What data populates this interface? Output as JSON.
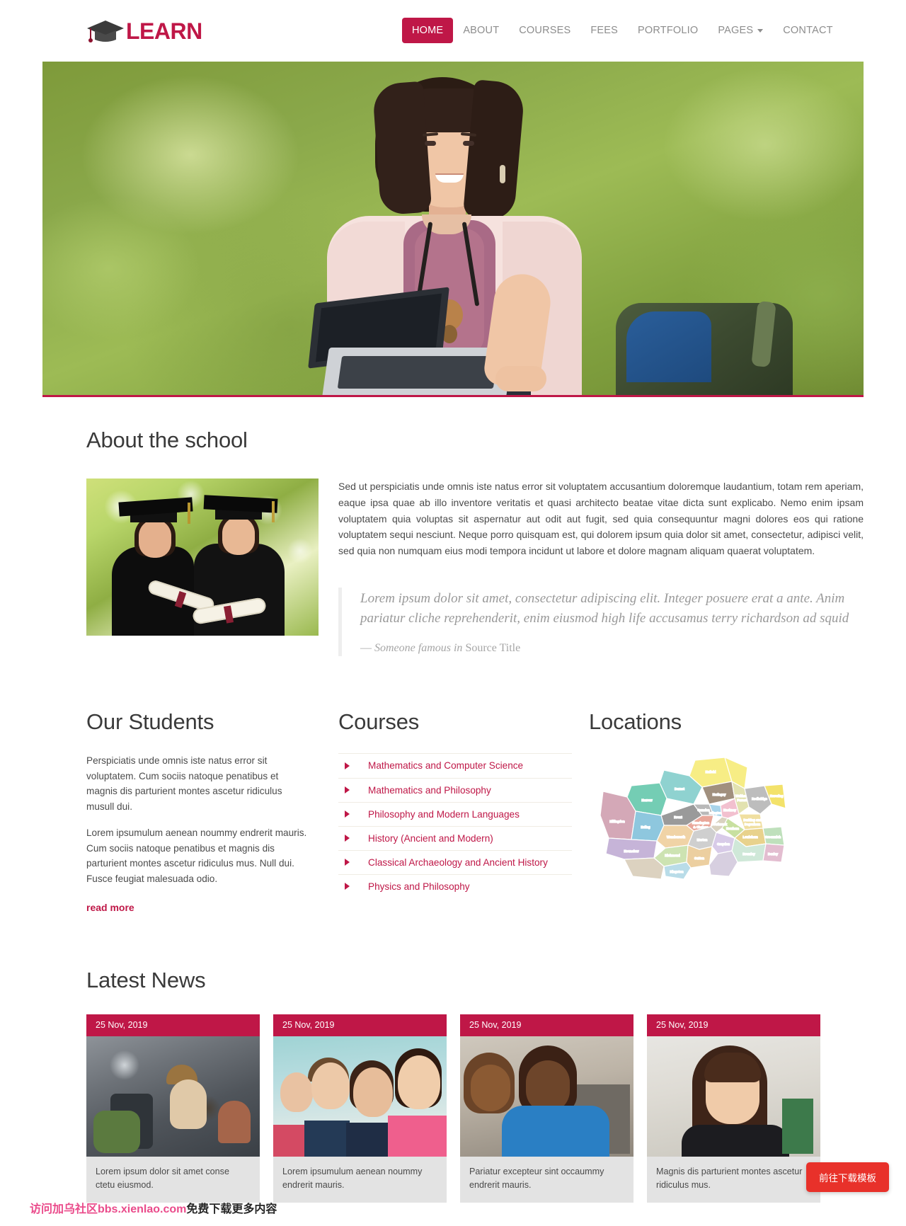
{
  "header": {
    "brand": {
      "text": "LEARN",
      "icon": "graduation-cap-icon",
      "color": "#bf1747"
    },
    "nav": [
      {
        "label": "HOME",
        "active": true
      },
      {
        "label": "ABOUT",
        "active": false
      },
      {
        "label": "COURSES",
        "active": false
      },
      {
        "label": "FEES",
        "active": false
      },
      {
        "label": "PORTFOLIO",
        "active": false
      },
      {
        "label": "PAGES",
        "active": false,
        "has_caret": true
      },
      {
        "label": "CONTACT",
        "active": false
      }
    ]
  },
  "hero": {
    "alt": "Student sitting outdoors with a laptop and backpack on a green bokeh background"
  },
  "about": {
    "title": "About the school",
    "image_alt": "Two graduates in caps and gowns holding diplomas",
    "paragraph": "Sed ut perspiciatis unde omnis iste natus error sit voluptatem accusantium doloremque laudantium, totam rem aperiam, eaque ipsa quae ab illo inventore veritatis et quasi architecto beatae vitae dicta sunt explicabo. Nemo enim ipsam voluptatem quia voluptas sit aspernatur aut odit aut fugit, sed quia consequuntur magni dolores eos qui ratione voluptatem sequi nesciunt. Neque porro quisquam est, qui dolorem ipsum quia dolor sit amet, consectetur, adipisci velit, sed quia non numquam eius modi tempora incidunt ut labore et dolore magnam aliquam quaerat voluptatem.",
    "quote": "Lorem ipsum dolor sit amet, consectetur adipiscing elit. Integer posuere erat a ante. Anim pariatur cliche reprehenderit, enim eiusmod high life accusamus terry richardson ad squid",
    "quote_dash": "—",
    "quote_author": "Someone famous",
    "quote_joiner": "in",
    "quote_source": "Source Title"
  },
  "students": {
    "title": "Our Students",
    "paragraphs": [
      "Perspiciatis unde omnis iste natus error sit voluptatem. Cum sociis natoque penatibus et magnis dis parturient montes ascetur ridiculus musull dui.",
      "Lorem ipsumulum aenean noummy endrerit mauris. Cum sociis natoque penatibus et magnis dis parturient montes ascetur ridiculus mus. Null dui. Fusce feugiat malesuada odio."
    ],
    "read_more": "read more"
  },
  "courses": {
    "title": "Courses",
    "items": [
      "Mathematics and Computer Science",
      "Mathematics and Philosophy",
      "Philosophy and Modern Languages",
      "History (Ancient and Modern)",
      "Classical Archaeology and Ancient History",
      "Physics and Philosophy"
    ]
  },
  "locations": {
    "title": "Locations",
    "map_alt": "Colour-coded map of the London boroughs",
    "boroughs": [
      {
        "name": "Enfield",
        "color": "#f7ed85"
      },
      {
        "name": "Barnet",
        "color": "#8fd2d0"
      },
      {
        "name": "Harrow",
        "color": "#74cdb4"
      },
      {
        "name": "Hillingdon",
        "color": "#d4a8b7"
      },
      {
        "name": "Brent",
        "color": "#9a9a9a"
      },
      {
        "name": "Haringey",
        "color": "#a1907e"
      },
      {
        "name": "Waltham Forest",
        "color": "#e2e2b0"
      },
      {
        "name": "Redbridge",
        "color": "#bdbdbd"
      },
      {
        "name": "Havering",
        "color": "#f3e26a"
      },
      {
        "name": "Camden",
        "color": "#b9b9b9"
      },
      {
        "name": "Islington",
        "color": "#a8d4ea"
      },
      {
        "name": "Hackney",
        "color": "#f2c0cf"
      },
      {
        "name": "Barking and Dagenham",
        "color": "#f0dfa0"
      },
      {
        "name": "Ealing",
        "color": "#8ec7de"
      },
      {
        "name": "Kensington & Chelsea",
        "color": "#e9a79a"
      },
      {
        "name": "Newham",
        "color": "#c8e0a0"
      },
      {
        "name": "Hounslow",
        "color": "#c6b4d8"
      },
      {
        "name": "Wandsworth",
        "color": "#f0d3a6"
      },
      {
        "name": "Southwark",
        "color": "#a7c7e0"
      },
      {
        "name": "Lewisham",
        "color": "#e8d28c"
      },
      {
        "name": "Greenwich",
        "color": "#bfe0bc"
      },
      {
        "name": "Bexley",
        "color": "#e3bdd0"
      },
      {
        "name": "Richmond",
        "color": "#cde3b2"
      },
      {
        "name": "Merton",
        "color": "#cfcfcf"
      },
      {
        "name": "Croydon",
        "color": "#d8cbe8"
      },
      {
        "name": "Bromley",
        "color": "#cfe8d8"
      },
      {
        "name": "Sutton",
        "color": "#eccfa0"
      },
      {
        "name": "Kingston",
        "color": "#b9dce8"
      }
    ]
  },
  "news": {
    "title": "Latest News",
    "cards": [
      {
        "date": "25 Nov, 2019",
        "caption": "Lorem ipsum dolor sit amet conse ctetu eiusmod.",
        "image_alt": "Students working at computers in a classroom"
      },
      {
        "date": "25 Nov, 2019",
        "caption": "Lorem ipsumulum aenean noummy endrerit mauris.",
        "image_alt": "Group of four smiling students"
      },
      {
        "date": "25 Nov, 2019",
        "caption": "Pariatur excepteur sint occaummy endrerit mauris.",
        "image_alt": "Two students working together at a computer"
      },
      {
        "date": "25 Nov, 2019",
        "caption": "Magnis dis parturient montes ascetur ridiculus mus.",
        "image_alt": "Smiling student holding a book"
      }
    ]
  },
  "overlay": {
    "download_button": "前往下载模板",
    "watermark_pink": "访问加乌社区bbs.xienlao.com",
    "watermark_dark": "免费下载更多内容"
  },
  "theme": {
    "accent": "#bf1747",
    "nav_inactive": "#8d8d8d",
    "heading": "#3a3a3a",
    "body_text": "#4b4b4b",
    "quote_text": "#999999",
    "news_card_bg": "#e3e3e3",
    "download_red": "#e8312a"
  }
}
